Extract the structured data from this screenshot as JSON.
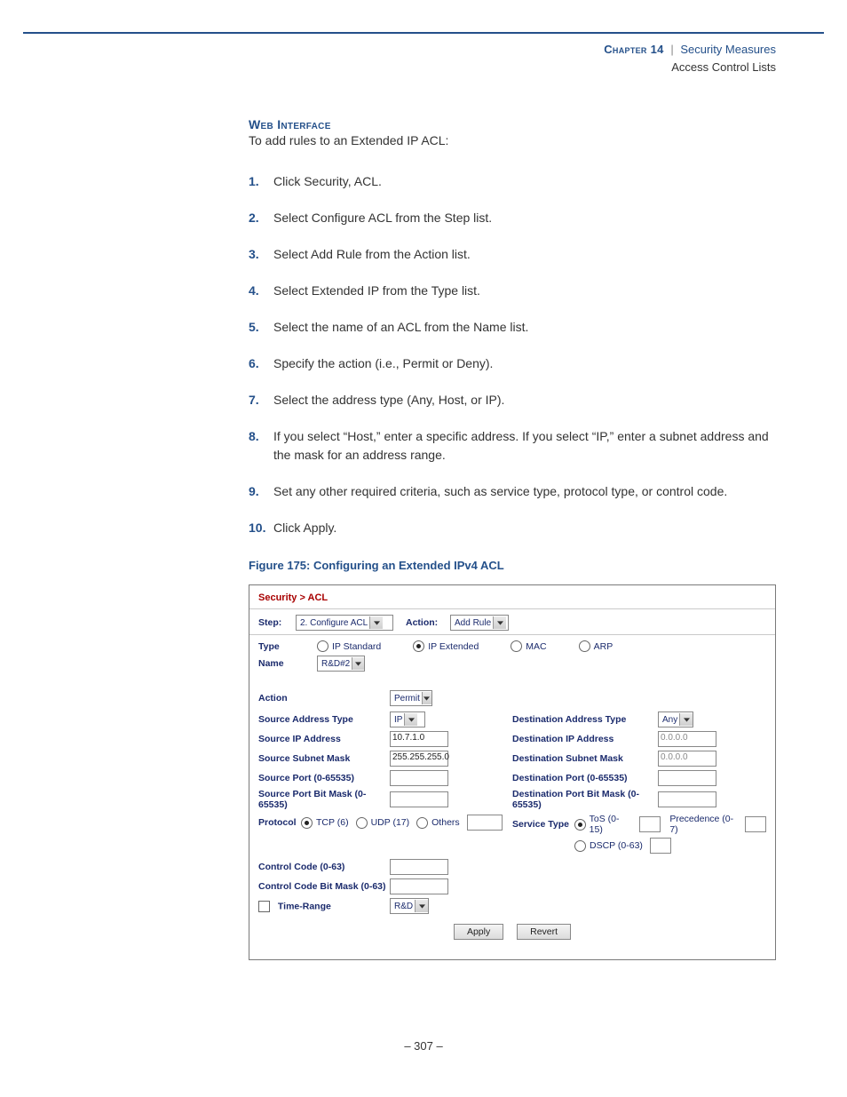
{
  "header": {
    "chapter": "Chapter 14",
    "sep": "|",
    "title": "Security Measures",
    "subtitle": "Access Control Lists"
  },
  "section_label": "Web Interface",
  "lead": "To add rules to an Extended IP ACL:",
  "steps": [
    "Click Security, ACL.",
    "Select Configure ACL from the Step list.",
    "Select Add Rule from the Action list.",
    "Select Extended IP from the Type list.",
    "Select the name of an ACL from the Name list.",
    "Specify the action (i.e., Permit or Deny).",
    "Select the address type (Any, Host, or IP).",
    "If you select “Host,” enter a specific address. If you select “IP,” enter a subnet address and the mask for an address range.",
    "Set any other required criteria, such as service type, protocol type, or control code.",
    "Click Apply."
  ],
  "figure_caption": "Figure 175:  Configuring an Extended IPv4 ACL",
  "screenshot": {
    "breadcrumb": "Security > ACL",
    "step": {
      "label": "Step:",
      "value": "2. Configure ACL"
    },
    "action": {
      "label": "Action:",
      "value": "Add Rule"
    },
    "type": {
      "label": "Type",
      "options": [
        {
          "label": "IP Standard",
          "checked": false
        },
        {
          "label": "IP Extended",
          "checked": true
        },
        {
          "label": "MAC",
          "checked": false
        },
        {
          "label": "ARP",
          "checked": false
        }
      ]
    },
    "name": {
      "label": "Name",
      "value": "R&D#2"
    },
    "action_field": {
      "label": "Action",
      "value": "Permit"
    },
    "left": {
      "src_addr_type": {
        "label": "Source Address Type",
        "value": "IP"
      },
      "src_ip": {
        "label": "Source IP Address",
        "value": "10.7.1.0"
      },
      "src_mask": {
        "label": "Source Subnet Mask",
        "value": "255.255.255.0"
      },
      "src_port": {
        "label": "Source Port (0-65535)",
        "value": ""
      },
      "src_port_mask": {
        "label": "Source Port Bit Mask (0-65535)",
        "value": ""
      }
    },
    "right": {
      "dst_addr_type": {
        "label": "Destination Address Type",
        "value": "Any"
      },
      "dst_ip": {
        "label": "Destination IP Address",
        "placeholder": "0.0.0.0"
      },
      "dst_mask": {
        "label": "Destination Subnet Mask",
        "placeholder": "0.0.0.0"
      },
      "dst_port": {
        "label": "Destination Port (0-65535)",
        "value": ""
      },
      "dst_port_mask": {
        "label": "Destination Port Bit Mask (0-65535)",
        "value": ""
      }
    },
    "protocol": {
      "label": "Protocol",
      "options": [
        {
          "label": "TCP (6)",
          "checked": true
        },
        {
          "label": "UDP (17)",
          "checked": false
        },
        {
          "label": "Others",
          "checked": false
        }
      ],
      "others_value": ""
    },
    "service_type": {
      "label": "Service Type",
      "options": [
        {
          "label": "ToS (0-15)",
          "checked": true,
          "value": ""
        },
        {
          "label": "DSCP (0-63)",
          "checked": false,
          "value": ""
        }
      ],
      "precedence": {
        "label": "Precedence (0-7)",
        "value": ""
      }
    },
    "control_code": {
      "label": "Control Code (0-63)",
      "value": ""
    },
    "control_code_mask": {
      "label": "Control Code Bit Mask (0-63)",
      "value": ""
    },
    "time_range": {
      "label": "Time-Range",
      "checked": false,
      "value": "R&D"
    },
    "buttons": {
      "apply": "Apply",
      "revert": "Revert"
    }
  },
  "page_number": "–  307  –"
}
